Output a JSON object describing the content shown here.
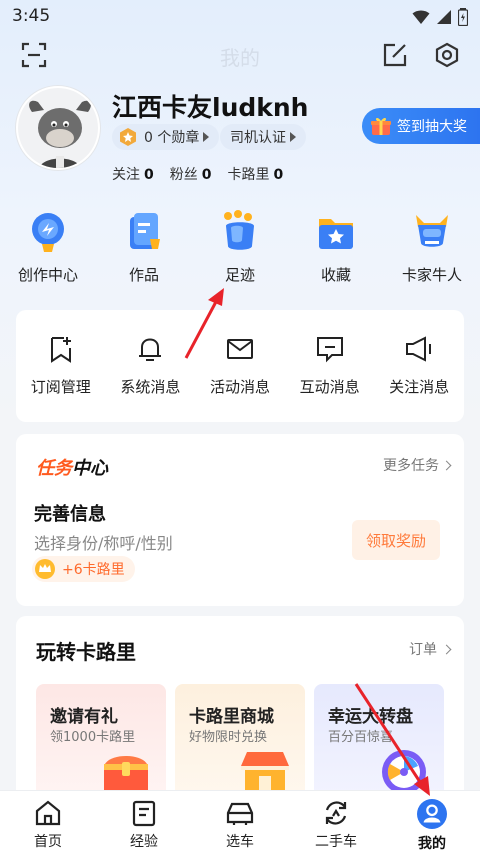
{
  "status_bar": {
    "time": "3:45"
  },
  "header": {
    "title": "我的"
  },
  "profile": {
    "username": "江西卡友ludknh",
    "badges_label": "0 个勋章",
    "driver_auth_label": "司机认证",
    "stats": [
      {
        "label": "关注",
        "value": "0"
      },
      {
        "label": "粉丝",
        "value": "0"
      },
      {
        "label": "卡路里",
        "value": "0"
      }
    ],
    "signin_label": "签到抽大奖"
  },
  "quick_actions": [
    {
      "label": "创作中心",
      "icon": "creation-center-icon"
    },
    {
      "label": "作品",
      "icon": "works-icon"
    },
    {
      "label": "足迹",
      "icon": "footprint-icon"
    },
    {
      "label": "收藏",
      "icon": "favorites-icon"
    },
    {
      "label": "卡家牛人",
      "icon": "truck-expert-icon"
    }
  ],
  "messages": [
    {
      "label": "订阅管理",
      "icon": "subscribe-icon"
    },
    {
      "label": "系统消息",
      "icon": "bell-icon"
    },
    {
      "label": "活动消息",
      "icon": "mail-icon"
    },
    {
      "label": "互动消息",
      "icon": "chat-icon"
    },
    {
      "label": "关注消息",
      "icon": "speaker-icon"
    }
  ],
  "task_center": {
    "title_a": "任务",
    "title_b": "中心",
    "more_label": "更多任务",
    "task_title": "完善信息",
    "task_desc": "选择身份/称呼/性别",
    "reward_label": "+6卡路里",
    "claim_label": "领取奖励"
  },
  "play": {
    "title": "玩转卡路里",
    "orders_label": "订单",
    "promos": [
      {
        "title": "邀请有礼",
        "subtitle": "领1000卡路里"
      },
      {
        "title": "卡路里商城",
        "subtitle": "好物限时兑换"
      },
      {
        "title": "幸运大转盘",
        "subtitle": "百分百惊喜"
      }
    ]
  },
  "tabbar": [
    {
      "label": "首页",
      "icon": "home-icon"
    },
    {
      "label": "经验",
      "icon": "experience-icon"
    },
    {
      "label": "选车",
      "icon": "car-select-icon"
    },
    {
      "label": "二手车",
      "icon": "used-car-icon"
    },
    {
      "label": "我的",
      "icon": "profile-icon",
      "active": true
    }
  ],
  "colors": {
    "accent": "#2d74f0",
    "arrow": "#e8232a",
    "reward": "#ff6a2c"
  }
}
